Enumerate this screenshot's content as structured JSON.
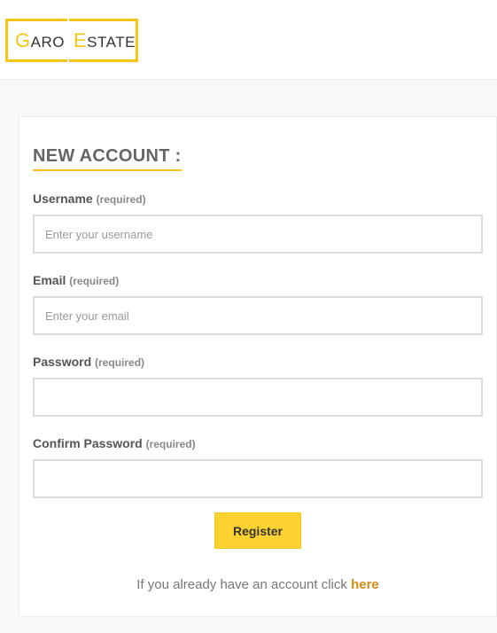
{
  "brand": {
    "logo_initial_1": "G",
    "logo_rest_1": "ARO",
    "logo_initial_2": "E",
    "logo_rest_2": "STATE",
    "accent_color": "#f5c518"
  },
  "form": {
    "title": "NEW ACCOUNT :",
    "fields": [
      {
        "label": "Username",
        "required_note": "(required)",
        "placeholder": "Enter your username",
        "value": ""
      },
      {
        "label": "Email",
        "required_note": "(required)",
        "placeholder": "Enter your email",
        "value": ""
      },
      {
        "label": "Password",
        "required_note": "(required)",
        "placeholder": "",
        "value": ""
      },
      {
        "label": "Confirm Password",
        "required_note": "(required)",
        "placeholder": "",
        "value": ""
      }
    ],
    "register_label": "Register",
    "login_prompt": "If you already have an account click ",
    "login_link": "here"
  }
}
